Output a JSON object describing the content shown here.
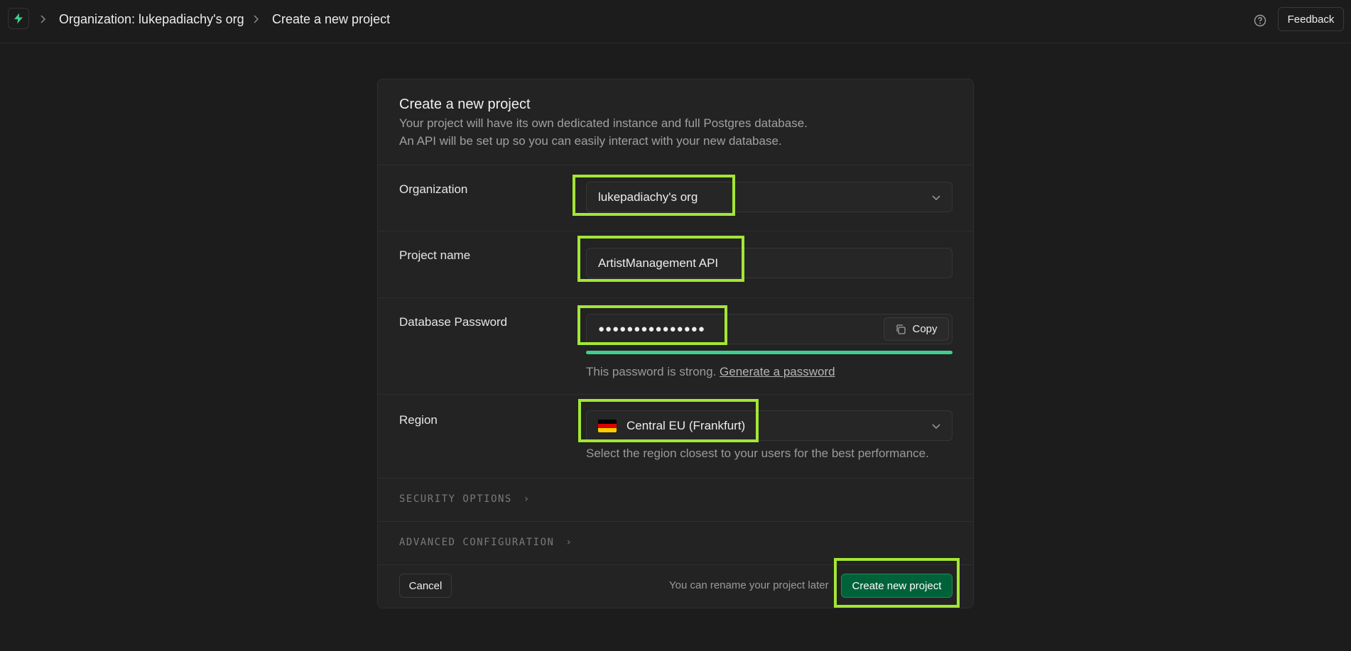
{
  "colors": {
    "highlight": "#a3e635",
    "brand_green": "#3ecf8e",
    "primary_button": "#006239"
  },
  "header": {
    "logo_icon": "bolt-icon",
    "breadcrumb": [
      "Organization: lukepadiachy's org",
      "Create a new project"
    ],
    "help_icon": "question-circle-icon",
    "feedback_label": "Feedback"
  },
  "card": {
    "title": "Create a new project",
    "description_line1": "Your project will have its own dedicated instance and full Postgres database.",
    "description_line2": "An API will be set up so you can easily interact with your new database.",
    "organization": {
      "label": "Organization",
      "value": "lukepadiachy's org"
    },
    "project_name": {
      "label": "Project name",
      "value": "ArtistManagement API"
    },
    "password": {
      "label": "Database Password",
      "value": "●●●●●●●●●●●●●●●",
      "copy_label": "Copy",
      "strength_text": "This password is strong.",
      "generate_link": "Generate a password"
    },
    "region": {
      "label": "Region",
      "value": "Central EU (Frankfurt)",
      "flag": "germany-flag",
      "help": "Select the region closest to your users for the best performance."
    },
    "security_options": "SECURITY OPTIONS",
    "advanced_configuration": "ADVANCED CONFIGURATION",
    "footer": {
      "cancel_label": "Cancel",
      "rename_note": "You can rename your project later",
      "create_label": "Create new project"
    }
  }
}
